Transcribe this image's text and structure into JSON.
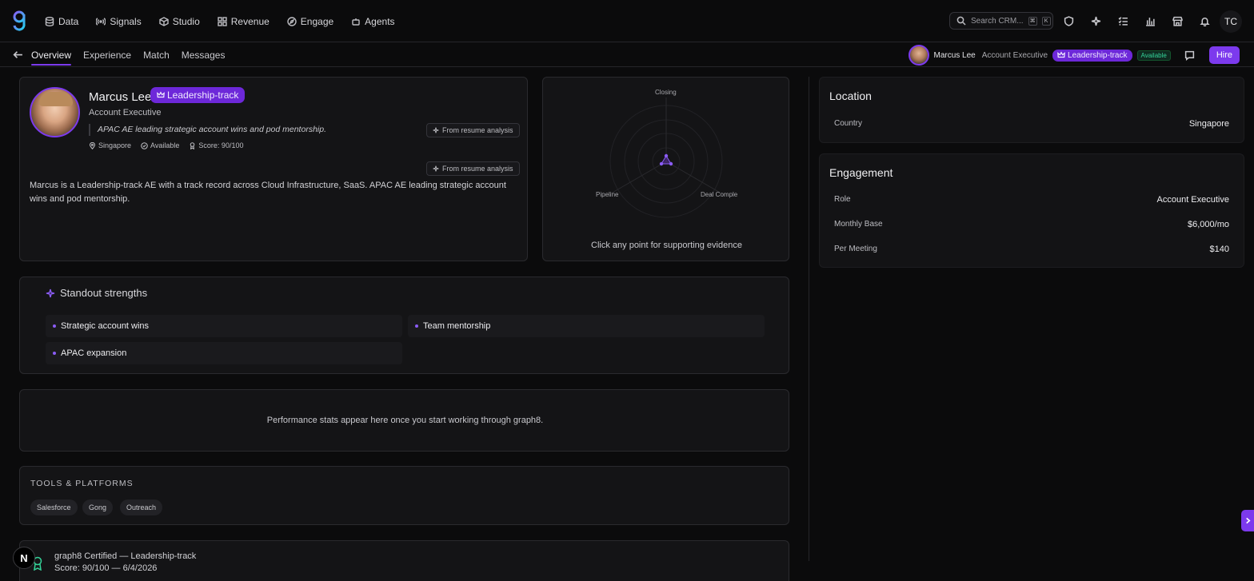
{
  "colors": {
    "accent": "#7c3aed",
    "available": "#34d399",
    "background": "#0b0b0c"
  },
  "nav": {
    "items": [
      {
        "label": "Data",
        "icon": "database-icon"
      },
      {
        "label": "Signals",
        "icon": "signal-icon"
      },
      {
        "label": "Studio",
        "icon": "cube-icon"
      },
      {
        "label": "Revenue",
        "icon": "grid-icon"
      },
      {
        "label": "Engage",
        "icon": "compass-icon"
      },
      {
        "label": "Agents",
        "icon": "robot-icon"
      }
    ],
    "search_placeholder": "Search CRM...",
    "search_kbd": [
      "⌘",
      "K"
    ],
    "user_initials": "TC"
  },
  "subnav": {
    "tabs": [
      "Overview",
      "Experience",
      "Match",
      "Messages"
    ],
    "active_tab": "Overview",
    "candidate_name": "Marcus Lee",
    "candidate_role": "Account Executive",
    "track_badge": "Leadership-track",
    "status_badge": "Available",
    "hire_label": "Hire"
  },
  "profile": {
    "name": "Marcus Lee",
    "badge": "Leadership-track",
    "role": "Account Executive",
    "quote": "APAC AE leading strategic account wins and pod mentorship.",
    "resume_tag": "From resume analysis",
    "location": "Singapore",
    "availability": "Available",
    "score": "Score: 90/100",
    "bio": "Marcus is a Leadership-track AE with a track record across Cloud Infrastructure, SaaS. APAC AE leading strategic account wins and pod mentorship."
  },
  "radar": {
    "axes": [
      "Closing",
      "Pipeline",
      "Deal Comple"
    ],
    "hint": "Click any point for supporting evidence"
  },
  "location_card": {
    "title": "Location",
    "rows": [
      {
        "label": "Country",
        "value": "Singapore"
      }
    ]
  },
  "engagement_card": {
    "title": "Engagement",
    "rows": [
      {
        "label": "Role",
        "value": "Account Executive"
      },
      {
        "label": "Monthly Base",
        "value": "$6,000/mo"
      },
      {
        "label": "Per Meeting",
        "value": "$140"
      }
    ]
  },
  "strengths": {
    "title": "Standout strengths",
    "items": [
      "Strategic account wins",
      "Team mentorship",
      "APAC expansion"
    ]
  },
  "performance": {
    "empty_text": "Performance stats appear here once you start working through graph8."
  },
  "tools": {
    "title": "TOOLS & PLATFORMS",
    "items": [
      "Salesforce",
      "Gong",
      "Outreach"
    ]
  },
  "certification": {
    "title": "graph8 Certified — Leadership-track",
    "detail": "Score: 90/100 — 6/4/2026"
  },
  "assistant_bubble": "N"
}
